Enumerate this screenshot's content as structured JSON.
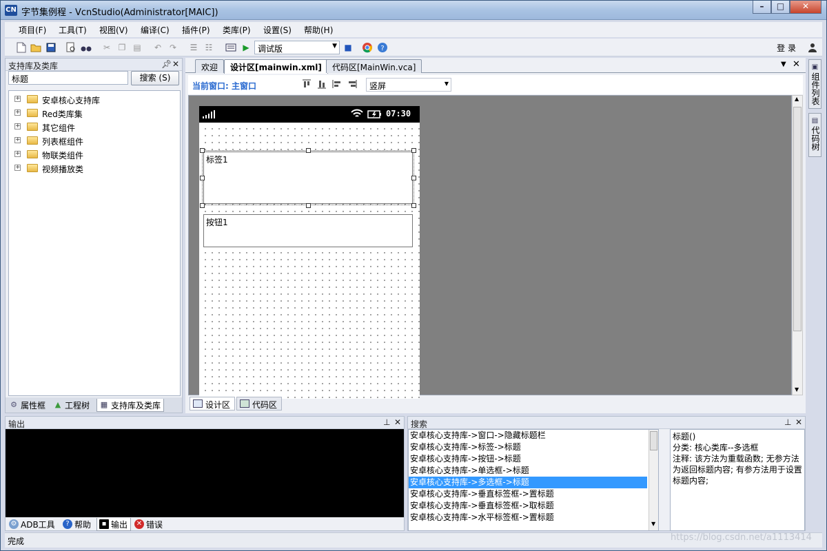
{
  "window": {
    "title": "字节集例程 - VcnStudio(Administrator[MAIC])",
    "app_icon": "CN",
    "controls": {
      "minimize": "–",
      "maximize": "□",
      "close": "✕"
    }
  },
  "menu": [
    "项目(F)",
    "工具(T)",
    "视图(V)",
    "编译(C)",
    "插件(P)",
    "类库(P)",
    "设置(S)",
    "帮助(H)"
  ],
  "toolbar": {
    "build_mode": "调试版",
    "login": "登 录"
  },
  "left_panel": {
    "title": "支持库及类库",
    "search_value": "标题",
    "search_button": "搜索 (S)",
    "tree": [
      "安卓核心支持库",
      "Red类库集",
      "其它组件",
      "列表框组件",
      "物联类组件",
      "视频播放类"
    ],
    "tabs": [
      "属性框",
      "工程树",
      "支持库及类库"
    ]
  },
  "doc": {
    "tabs": [
      "欢迎",
      "设计区[mainwin.xml]",
      "代码区[MainWin.vca]"
    ],
    "current_window": "当前窗口: 主窗口",
    "orientation": "竖屏",
    "phone_time": "07:30",
    "components": {
      "label": "标签1",
      "button": "按钮1"
    },
    "bottom_tabs": [
      "设计区",
      "代码区"
    ]
  },
  "right_strip": [
    "组件列表",
    "代码树"
  ],
  "output_panel": {
    "title": "输出",
    "tabs": [
      "ADB工具",
      "帮助",
      "输出",
      "错误"
    ]
  },
  "search_panel": {
    "title": "搜索",
    "results": [
      "安卓核心支持库->窗口->隐藏标题栏",
      "安卓核心支持库->标签->标题",
      "安卓核心支持库->按钮->标题",
      "安卓核心支持库->单选框->标题",
      "安卓核心支持库->多选框->标题",
      "安卓核心支持库->垂直标签框->置标题",
      "安卓核心支持库->垂直标签框->取标题",
      "安卓核心支持库->水平标签框->置标题"
    ],
    "selected_index": 4,
    "detail": [
      "标题()",
      "分类: 核心类库--多选框",
      "注释: 该方法为重载函数; 无参方法为返回标题内容; 有参方法用于设置标题内容;"
    ]
  },
  "status": "完成",
  "watermark": "https://blog.csdn.net/a1113414"
}
